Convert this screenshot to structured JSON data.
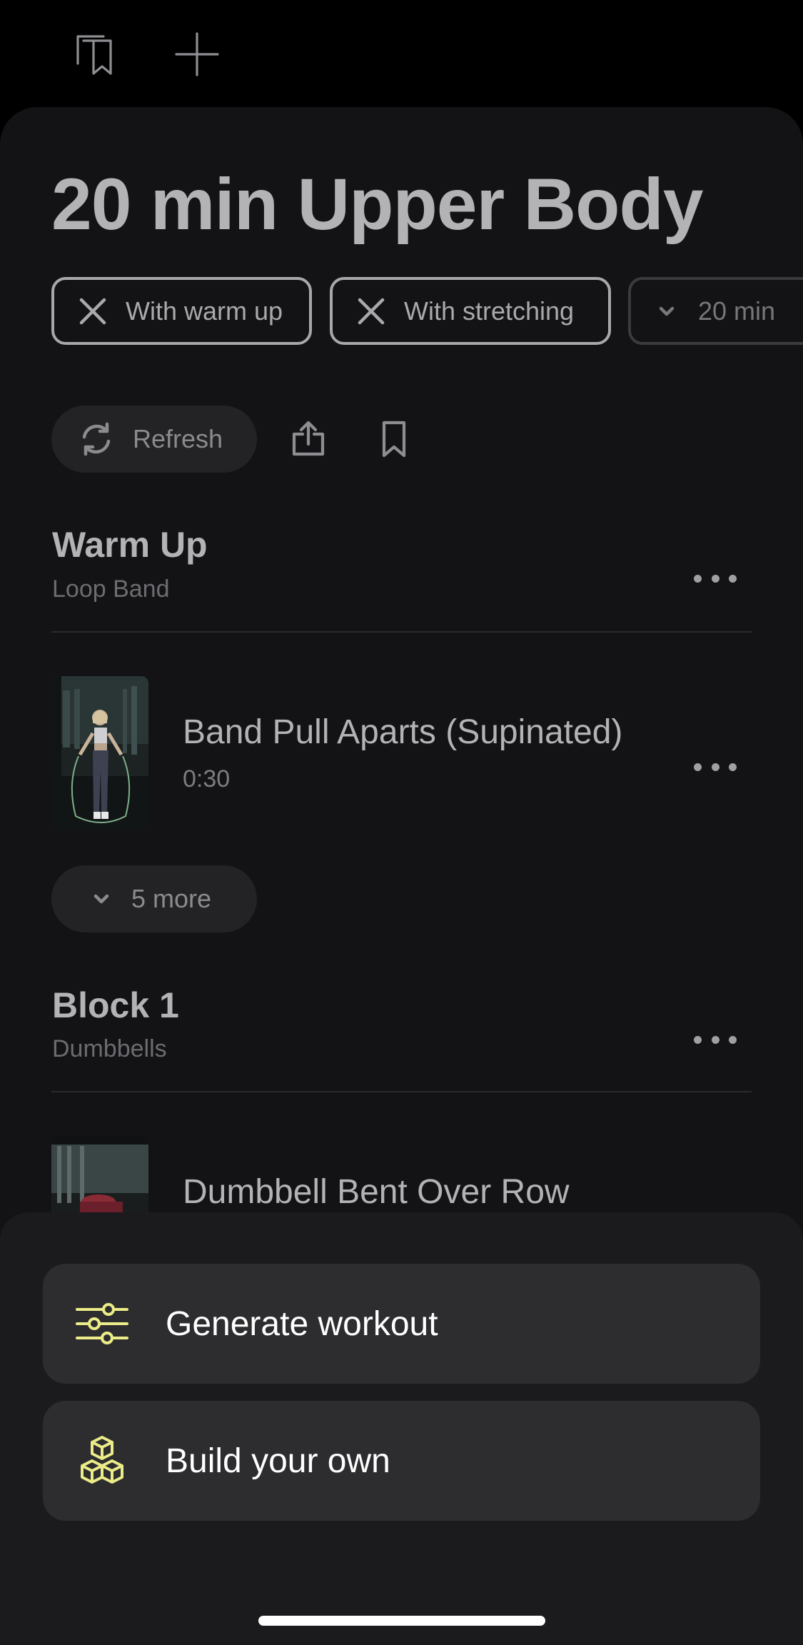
{
  "top_bar": {
    "icons": [
      "saved-workouts-icon",
      "plus-icon"
    ]
  },
  "workout": {
    "title": "20 min Upper Body",
    "chips": [
      {
        "label": "With warm up",
        "icon": "close-icon"
      },
      {
        "label": "With stretching",
        "icon": "close-icon"
      },
      {
        "label": "20 min",
        "icon": "chevron-down-icon"
      }
    ],
    "actions": {
      "refresh_label": "Refresh"
    }
  },
  "sections": [
    {
      "title": "Warm Up",
      "equipment": "Loop Band",
      "exercises": [
        {
          "name": "Band Pull Aparts (Supinated)",
          "duration": "0:30"
        }
      ],
      "more_label": "5 more"
    },
    {
      "title": "Block 1",
      "equipment": "Dumbbells",
      "exercises": [
        {
          "name": "Dumbbell Bent Over Row"
        }
      ]
    }
  ],
  "bottom_panel": {
    "generate_label": "Generate workout",
    "build_label": "Build your own"
  },
  "colors": {
    "background": "#131316",
    "accent_icon": "#ecec88",
    "card": "#2d2d30"
  }
}
